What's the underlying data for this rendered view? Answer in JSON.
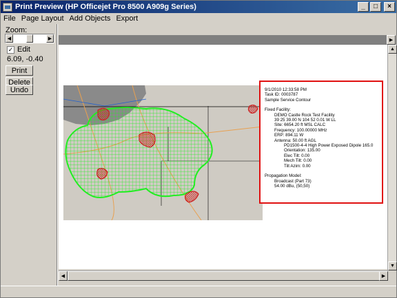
{
  "window": {
    "title": "Print Preview (HP Officejet Pro 8500 A909g Series)"
  },
  "titlebar_buttons": {
    "minimize": "_",
    "maximize": "□",
    "close": "×"
  },
  "menu": [
    "File",
    "Page Layout",
    "Add Objects",
    "Export"
  ],
  "left_panel": {
    "zoom_label": "Zoom:",
    "zoom_level": 0.5,
    "edit_label": "Edit",
    "edit_checked": "✓",
    "coords": "6.09, -0.40",
    "print_label": "Print",
    "delete_label": "Delete",
    "undo_label": "Undo"
  },
  "info_box": {
    "lines": [
      {
        "text": "9/1/2010 12:33:58 PM",
        "indent": 0
      },
      {
        "text": "Task ID: 0003787",
        "indent": 0
      },
      {
        "text": "Sample Service Contour",
        "indent": 0
      },
      {
        "text": "",
        "indent": 0
      },
      {
        "text": "Fixed Facility:",
        "indent": 0
      },
      {
        "text": "DEMO Castle Rock Test Facility",
        "indent": 1
      },
      {
        "text": "39 25 39.00 N 104 52 0.01 W LL",
        "indent": 1
      },
      {
        "text": "Site: 6654.20 ft MSL CALC",
        "indent": 1
      },
      {
        "text": "Frequency: 100.00000 MHz",
        "indent": 1
      },
      {
        "text": "ERP: 894.11 W",
        "indent": 1
      },
      {
        "text": "Antenna: 50.00 ft AGL",
        "indent": 1
      },
      {
        "text": "PD1500-4-4 High Power Exposed Dipole 165.0",
        "indent": 2
      },
      {
        "text": "Orientation: 135.00",
        "indent": 2
      },
      {
        "text": "Elec Tilt: 0.00",
        "indent": 2
      },
      {
        "text": "Mech Tilt: 0.00",
        "indent": 2
      },
      {
        "text": "Tilt Azim: 0.00",
        "indent": 2
      },
      {
        "text": "",
        "indent": 0
      },
      {
        "text": "Propagation Model:",
        "indent": 0
      },
      {
        "text": "Broadcast (Part 73)",
        "indent": 1
      },
      {
        "text": "54.00 dBu, (50,50)",
        "indent": 1
      }
    ]
  },
  "colors": {
    "title_bar": "#0a246a",
    "info_border": "#e01010",
    "contour": "#22ee22",
    "interference": "#cc2222",
    "map_bg": "#cfcbc3",
    "urban": "#8a8a8a"
  }
}
